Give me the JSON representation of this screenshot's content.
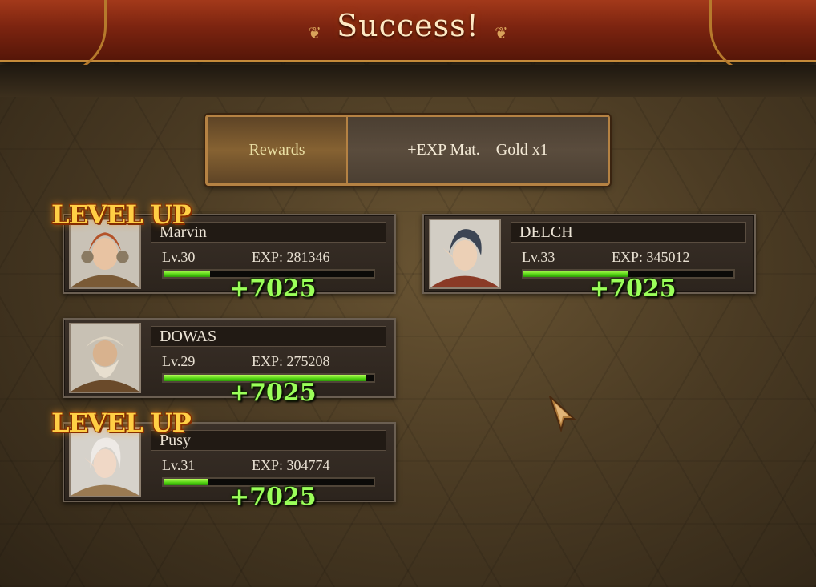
{
  "header": {
    "title": "Success!"
  },
  "rewards": {
    "label": "Rewards",
    "value": "+EXP Mat. – Gold x1"
  },
  "characters": [
    {
      "name": "Marvin",
      "level": "Lv.30",
      "exp": "EXP: 281346",
      "exp_progress": 0.22,
      "gain": "+7025",
      "level_up": "LEVEL UP",
      "portrait": "redhead-horned-character"
    },
    {
      "name": "DELCH",
      "level": "Lv.33",
      "exp": "EXP: 345012",
      "exp_progress": 0.5,
      "gain": "+7025",
      "level_up": null,
      "portrait": "dark-haired-elf-character"
    },
    {
      "name": "DOWAS",
      "level": "Lv.29",
      "exp": "EXP: 275208",
      "exp_progress": 0.96,
      "gain": "+7025",
      "level_up": null,
      "portrait": "bearded-dwarf-character"
    },
    {
      "name": "Pusy",
      "level": "Lv.31",
      "exp": "EXP: 304774",
      "exp_progress": 0.21,
      "gain": "+7025",
      "level_up": "LEVEL UP",
      "portrait": "white-haired-elf-character"
    }
  ],
  "cursor": {
    "icon": "pointer-cursor-icon"
  },
  "colors": {
    "header": "#7c2410",
    "exp_bar": "#4fd010",
    "gain_text": "#9bff5a",
    "level_up": "#ffcf45"
  }
}
